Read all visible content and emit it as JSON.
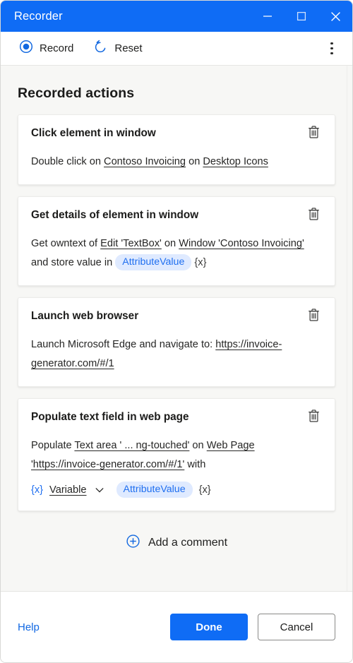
{
  "window": {
    "title": "Recorder",
    "minimize_icon": "minimize-icon",
    "maximize_icon": "maximize-icon",
    "close_icon": "close-icon"
  },
  "toolbar": {
    "record_label": "Record",
    "record_icon": "record-icon",
    "reset_label": "Reset",
    "reset_icon": "reset-icon",
    "more_icon": "more-vertical-icon"
  },
  "main": {
    "page_title": "Recorded actions",
    "delete_icon": "trash-icon",
    "actions": [
      {
        "title": "Click element in window",
        "parts": [
          {
            "type": "text",
            "text": "Double click on "
          },
          {
            "type": "link",
            "text": "Contoso Invoicing"
          },
          {
            "type": "text",
            "text": " on "
          },
          {
            "type": "link",
            "text": "Desktop Icons"
          }
        ]
      },
      {
        "title": "Get details of element in window",
        "parts": [
          {
            "type": "text",
            "text": "Get owntext of "
          },
          {
            "type": "link",
            "text": "Edit 'TextBox'"
          },
          {
            "type": "text",
            "text": " on "
          },
          {
            "type": "link",
            "text": "Window 'Contoso Invoicing'"
          },
          {
            "type": "text",
            "text": " and store value in "
          },
          {
            "type": "chip",
            "text": "AttributeValue"
          },
          {
            "type": "brace",
            "text": "{x}"
          }
        ]
      },
      {
        "title": "Launch web browser",
        "parts": [
          {
            "type": "text",
            "text": "Launch Microsoft Edge and navigate to: "
          },
          {
            "type": "link",
            "text": "https://invoice-generator.com/#/1"
          }
        ]
      },
      {
        "title": "Populate text field in web page",
        "parts": [
          {
            "type": "text",
            "text": "Populate "
          },
          {
            "type": "link",
            "text": "Text area ' ...  ng-touched'"
          },
          {
            "type": "text",
            "text": " on "
          },
          {
            "type": "link",
            "text": "Web Page 'https://invoice-generator.com/#/1'"
          },
          {
            "type": "text",
            "text": " with"
          }
        ],
        "variable_row": {
          "brace_prefix": "{x}",
          "selector_label": "Variable",
          "chevron_icon": "chevron-down-icon",
          "chip": "AttributeValue",
          "brace_suffix": "{x}"
        }
      }
    ],
    "add_comment_label": "Add a comment",
    "add_comment_icon": "plus-circle-icon"
  },
  "footer": {
    "help_label": "Help",
    "done_label": "Done",
    "cancel_label": "Cancel"
  },
  "colors": {
    "accent": "#0f6cf5",
    "titlebar": "#0f6cf5",
    "chip_bg": "#dfeaff",
    "chip_text": "#1f6ff0",
    "page_bg": "#f7f7f5",
    "card_bg": "#ffffff",
    "link_text": "#262625"
  }
}
